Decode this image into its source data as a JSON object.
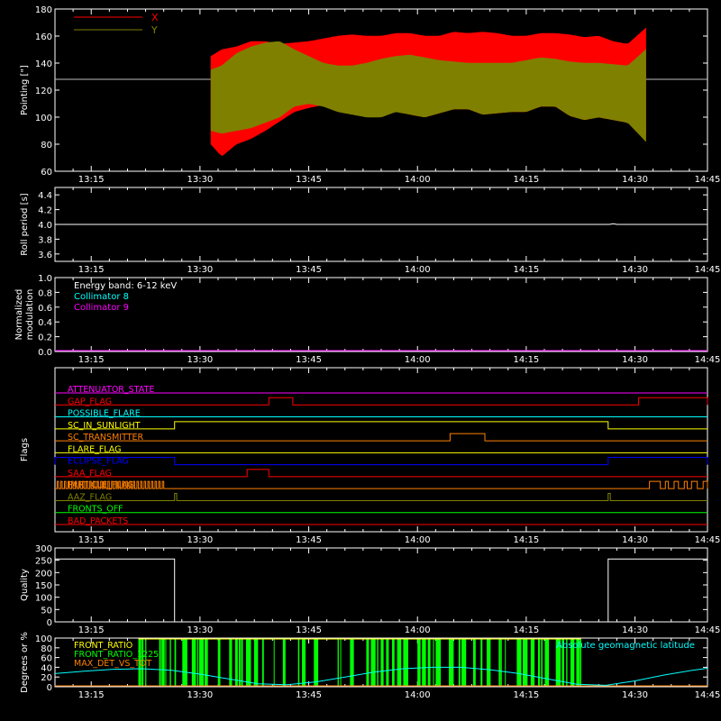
{
  "colors": {
    "background": "#000000",
    "axes": "#ffffff",
    "x_series": "#ff0000",
    "y_series": "#808000",
    "collimator8": "#00ffff",
    "collimator9": "#ff00ff",
    "front_ratio_1225": "#00ff00",
    "front_ratio": "#ffff00",
    "max_det_vs_tot": "#ff8000",
    "geomag": "#00ffff"
  },
  "time_axis": {
    "range_min": [
      0,
      90
    ],
    "ticks": [
      {
        "t": 5,
        "label": "13:15"
      },
      {
        "t": 20,
        "label": "13:30"
      },
      {
        "t": 35,
        "label": "13:45"
      },
      {
        "t": 50,
        "label": "14:00"
      },
      {
        "t": 65,
        "label": "14:15"
      },
      {
        "t": 80,
        "label": "14:30"
      },
      {
        "t": 95,
        "label": "14:45"
      }
    ]
  },
  "chart_data": [
    {
      "type": "area",
      "name": "pointing",
      "ylabel": "Pointing [\"]",
      "ylim": [
        60,
        180
      ],
      "yticks": [
        "60",
        "80",
        "100",
        "120",
        "140",
        "160",
        "180"
      ],
      "reference_line": 128,
      "legend": [
        {
          "label": "X",
          "color": "#ff0000"
        },
        {
          "label": "Y",
          "color": "#808000"
        }
      ],
      "active_range": [
        21.5,
        81.5
      ],
      "series": [
        {
          "name": "X",
          "t": [
            21.5,
            23,
            25,
            27,
            29,
            31,
            33,
            35,
            37,
            39,
            41,
            43,
            45,
            47,
            49,
            51,
            53,
            55,
            57,
            59,
            61,
            63,
            65,
            67,
            69,
            71,
            73,
            75,
            77,
            79,
            81.5
          ],
          "min": [
            80,
            71,
            80,
            84,
            90,
            97,
            104,
            107,
            109,
            108,
            106,
            102,
            102,
            106,
            102,
            100,
            103,
            106,
            106,
            102,
            103,
            104,
            104,
            108,
            108,
            101,
            98,
            100,
            98,
            96,
            88
          ],
          "max": [
            145,
            150,
            152,
            156,
            156,
            154,
            155,
            156,
            158,
            160,
            161,
            160,
            160,
            162,
            162,
            160,
            160,
            163,
            162,
            163,
            162,
            160,
            160,
            162,
            162,
            161,
            159,
            160,
            156,
            154,
            166
          ]
        },
        {
          "name": "Y",
          "t": [
            21.5,
            23,
            25,
            27,
            29,
            31,
            33,
            35,
            37,
            39,
            41,
            43,
            45,
            47,
            49,
            51,
            53,
            55,
            57,
            59,
            61,
            63,
            65,
            67,
            69,
            71,
            73,
            75,
            77,
            79,
            81.5
          ],
          "min": [
            90,
            88,
            90,
            92,
            96,
            100,
            108,
            110,
            108,
            104,
            102,
            100,
            100,
            104,
            102,
            100,
            103,
            106,
            106,
            102,
            103,
            104,
            104,
            108,
            108,
            101,
            98,
            100,
            98,
            96,
            82
          ],
          "max": [
            135,
            138,
            147,
            152,
            155,
            156,
            150,
            145,
            140,
            138,
            138,
            140,
            143,
            145,
            146,
            144,
            142,
            141,
            140,
            140,
            140,
            140,
            142,
            144,
            143,
            141,
            140,
            140,
            139,
            138,
            150
          ]
        }
      ]
    },
    {
      "type": "line",
      "name": "roll_period",
      "ylabel": "Roll period [s]",
      "ylim": [
        3.5,
        4.5
      ],
      "yticks": [
        "3.6",
        "3.8",
        "4.0",
        "4.2",
        "4.4"
      ],
      "series": [
        {
          "name": "roll",
          "t": [
            0,
            76.5,
            77,
            77.5,
            90
          ],
          "y": [
            4.0,
            4.0,
            4.01,
            4.0,
            4.0
          ]
        }
      ]
    },
    {
      "type": "line",
      "name": "modulation",
      "ylabel": [
        "Normalized",
        "modulation"
      ],
      "ylim": [
        0,
        1
      ],
      "yticks": [
        "0.0",
        "0.2",
        "0.4",
        "0.6",
        "0.8",
        "1.0"
      ],
      "annotations": [
        {
          "text": "Energy band: 6-12 keV",
          "color": "#ffffff"
        },
        {
          "text": "Collimator 8",
          "color": "#00ffff"
        },
        {
          "text": "Collimator 9",
          "color": "#ff00ff"
        }
      ],
      "series": [
        {
          "name": "Collimator 8",
          "t": [
            0,
            90
          ],
          "y": [
            0,
            0
          ],
          "color": "#00ffff"
        },
        {
          "name": "Collimator 9",
          "t": [
            0,
            90
          ],
          "y": [
            0,
            0
          ],
          "color": "#ff00ff"
        }
      ]
    },
    {
      "type": "line",
      "name": "flags",
      "ylabel": "Flags",
      "rows": [
        {
          "label": "ATTENUATOR_STATE",
          "color": "#ff00ff",
          "high": []
        },
        {
          "label": "GAP_FLAG",
          "color": "#ff0000",
          "high": [
            [
              29.5,
              32.8
            ],
            [
              80.5,
              90
            ]
          ]
        },
        {
          "label": "POSSIBLE_FLARE",
          "color": "#00ffff",
          "high": []
        },
        {
          "label": "SC_IN_SUNLIGHT",
          "color": "#ffff00",
          "high": [
            [
              16.5,
              76.3
            ]
          ]
        },
        {
          "label": "SC_TRANSMITTER",
          "color": "#ff8000",
          "high": [
            [
              54.5,
              59.3
            ]
          ]
        },
        {
          "label": "FLARE_FLAG",
          "color": "#ffff00",
          "high": []
        },
        {
          "label": "ECLIPSE_FLAG",
          "color": "#0000ff",
          "high": [
            [
              0,
              16.5
            ],
            [
              76.3,
              90
            ]
          ]
        },
        {
          "label": "SAA_FLAG",
          "color": "#ff0000",
          "high": [
            [
              26.5,
              29.5
            ]
          ]
        },
        {
          "label": "PARTICLE_FLAG",
          "color": "#ff8000",
          "high": [
            [
              0.3,
              0.5
            ],
            [
              0.8,
              1.0
            ],
            [
              1.3,
              1.5
            ],
            [
              1.8,
              2.0
            ],
            [
              2.3,
              2.5
            ],
            [
              2.8,
              3.0
            ],
            [
              3.3,
              3.5
            ],
            [
              3.8,
              4.0
            ],
            [
              4.3,
              4.5
            ],
            [
              4.8,
              5.0
            ],
            [
              5.3,
              5.5
            ],
            [
              5.8,
              6.0
            ],
            [
              6.3,
              6.5
            ],
            [
              6.8,
              7.0
            ],
            [
              7.3,
              7.5
            ],
            [
              7.8,
              8.0
            ],
            [
              8.3,
              8.5
            ],
            [
              8.8,
              9.0
            ],
            [
              9.3,
              9.5
            ],
            [
              9.8,
              10.0
            ],
            [
              10.3,
              10.5
            ],
            [
              10.8,
              11.0
            ],
            [
              11.3,
              11.5
            ],
            [
              11.8,
              12.0
            ],
            [
              12.3,
              12.5
            ],
            [
              12.8,
              13.0
            ],
            [
              13.3,
              13.5
            ],
            [
              13.8,
              14.0
            ],
            [
              14.3,
              14.5
            ],
            [
              14.8,
              15.0
            ],
            [
              82,
              83.5
            ],
            [
              84.2,
              84.6
            ],
            [
              85.4,
              86
            ],
            [
              86.8,
              87.2
            ],
            [
              87.8,
              88.6
            ],
            [
              89.4,
              90
            ]
          ]
        },
        {
          "label": "AAZ_FLAG",
          "color": "#808000",
          "high": [
            [
              16.5,
              16.8
            ],
            [
              76.3,
              76.6
            ]
          ]
        },
        {
          "label": "FRONTS_OFF",
          "color": "#00ff00",
          "high": []
        },
        {
          "label": "BAD_PACKETS",
          "color": "#ff0000",
          "high": []
        }
      ]
    },
    {
      "type": "line",
      "name": "quality",
      "ylabel": "Quality",
      "ylim": [
        0,
        300
      ],
      "yticks": [
        "0",
        "50",
        "100",
        "150",
        "200",
        "250",
        "300"
      ],
      "series": [
        {
          "name": "quality",
          "t": [
            0,
            16.5,
            16.5,
            76.3,
            76.3,
            90
          ],
          "y": [
            255,
            255,
            0,
            0,
            255,
            255
          ]
        }
      ]
    },
    {
      "type": "line",
      "name": "ratios",
      "ylabel": "Degrees or %",
      "ylim": [
        0,
        100
      ],
      "yticks": [
        "0",
        "20",
        "40",
        "60",
        "80",
        "100"
      ],
      "legend": [
        {
          "label": "FRONT_RATIO",
          "color": "#ffff00"
        },
        {
          "label": "FRONT_RATIO_1225",
          "color": "#00ff00"
        },
        {
          "label": "MAX_DET_VS_TOT",
          "color": "#ff8000"
        }
      ],
      "right_label": {
        "text": "Absolute geomagnetic latitude",
        "color": "#00ffff"
      },
      "green_range": [
        11.5,
        72.5
      ],
      "geomag": {
        "t": [
          0,
          4,
          8,
          12,
          16,
          20,
          24,
          28,
          32,
          36,
          40,
          44,
          48,
          52,
          56,
          60,
          64,
          68,
          72,
          76,
          80,
          84,
          88,
          90
        ],
        "y": [
          27,
          32,
          36,
          37,
          34,
          26,
          16,
          6,
          4,
          10,
          20,
          30,
          37,
          40,
          40,
          35,
          27,
          16,
          5,
          3,
          12,
          24,
          34,
          38
        ]
      }
    }
  ]
}
